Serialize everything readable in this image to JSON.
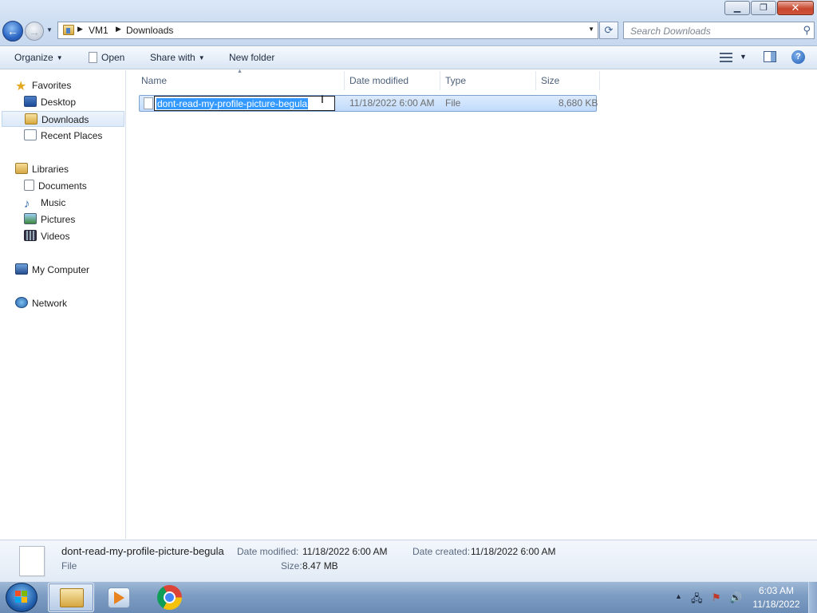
{
  "window": {
    "minimize_glyph": "▁",
    "maximize_glyph": "❐",
    "close_glyph": "✕"
  },
  "nav": {
    "back_glyph": "←",
    "forward_glyph": "→",
    "dropdown_glyph": "▼"
  },
  "address": {
    "breadcrumbs": [
      "VM1",
      "Downloads"
    ],
    "separator": "▶",
    "dropdown_glyph": "▼",
    "refresh_glyph": "⟳"
  },
  "search": {
    "placeholder": "Search Downloads",
    "icon_glyph": "⚲"
  },
  "toolbar": {
    "organize_label": "Organize",
    "open_label": "Open",
    "share_label": "Share with",
    "new_folder_label": "New folder",
    "dropdown_glyph": "▼",
    "help_glyph": "?"
  },
  "sidebar": {
    "favorites": {
      "label": "Favorites",
      "icon": "star-icon"
    },
    "favorites_items": [
      {
        "label": "Desktop",
        "icon": "desktop-icon"
      },
      {
        "label": "Downloads",
        "icon": "downloads-folder-icon",
        "selected": true
      },
      {
        "label": "Recent Places",
        "icon": "recent-places-icon"
      }
    ],
    "libraries": {
      "label": "Libraries",
      "icon": "libraries-icon"
    },
    "libraries_items": [
      {
        "label": "Documents",
        "icon": "documents-icon"
      },
      {
        "label": "Music",
        "icon": "music-icon"
      },
      {
        "label": "Pictures",
        "icon": "pictures-icon"
      },
      {
        "label": "Videos",
        "icon": "videos-icon"
      }
    ],
    "computer": {
      "label": "My Computer",
      "icon": "computer-icon"
    },
    "network": {
      "label": "Network",
      "icon": "network-icon"
    },
    "star_glyph": "★",
    "music_glyph": "♪"
  },
  "columns": {
    "name": "Name",
    "date_modified": "Date modified",
    "type": "Type",
    "size": "Size",
    "sort_glyph": "▲"
  },
  "files": [
    {
      "name": "dont-read-my-profile-picture-begula",
      "date_modified": "11/18/2022 6:00 AM",
      "type": "File",
      "size": "8,680 KB",
      "renaming": true
    }
  ],
  "cursor_glyph": "I",
  "details": {
    "name": "dont-read-my-profile-picture-begula",
    "type": "File",
    "date_modified_label": "Date modified:",
    "date_modified": "11/18/2022 6:00 AM",
    "size_label": "Size:",
    "size": "8.47 MB",
    "date_created_label": "Date created:",
    "date_created": "11/18/2022 6:00 AM"
  },
  "taskbar": {
    "apps": [
      "windows-explorer",
      "windows-media-player",
      "google-chrome"
    ],
    "tray": {
      "show_hidden_glyph": "▲",
      "network_glyph": "🖧",
      "flag_glyph": "⚑",
      "volume_glyph": "🔊"
    },
    "clock_time": "6:03 AM",
    "clock_date": "11/18/2022"
  },
  "colors": {
    "selection_blue": "#3399ff",
    "row_highlight": "#cfe3fc",
    "taskbar": "#7f9ec4"
  }
}
